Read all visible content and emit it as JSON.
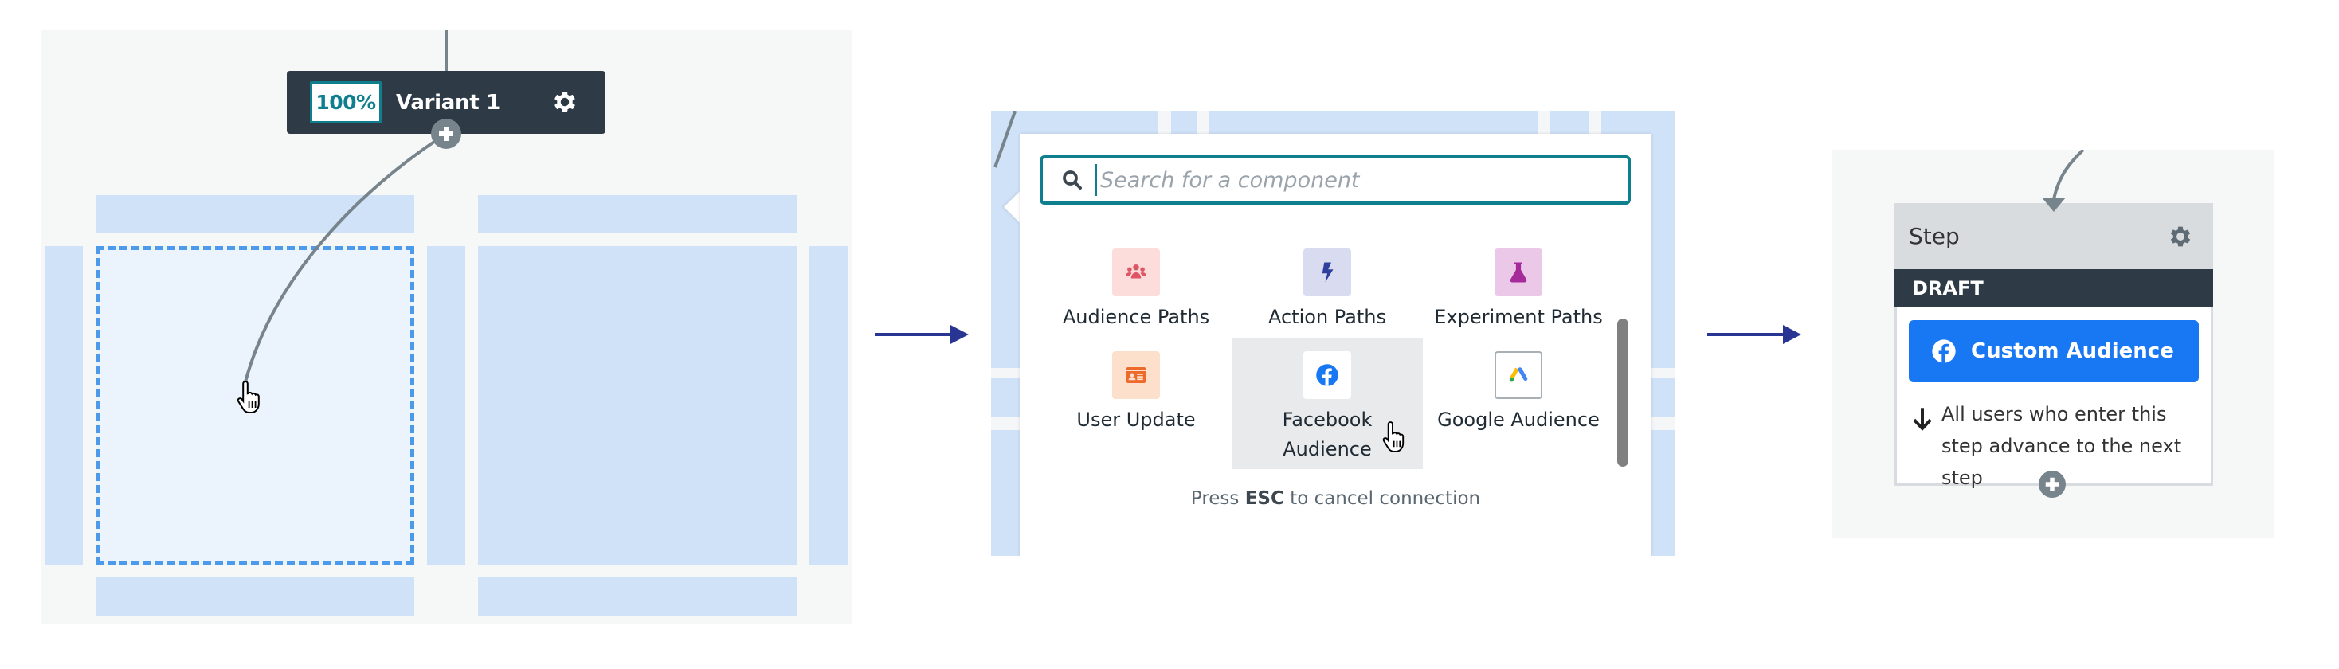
{
  "panel1": {
    "variant": {
      "percent_label": "100%",
      "name": "Variant 1",
      "settings_icon": "gear-icon",
      "add_icon": "plus-circle-icon"
    },
    "cursor": "hand-pointer-cursor"
  },
  "flow_arrows": [
    "arrow-right-icon",
    "arrow-right-icon"
  ],
  "panel2": {
    "search": {
      "placeholder": "Search for a component",
      "value": "",
      "icon": "search-icon"
    },
    "components": [
      {
        "label": "Audience Paths",
        "icon": "users-icon",
        "tile_color": "#fddcdc",
        "icon_color": "#e05564",
        "hovered": false
      },
      {
        "label": "Action Paths",
        "icon": "bolt-icon",
        "tile_color": "#d9dcf0",
        "icon_color": "#2f3f9e",
        "hovered": false
      },
      {
        "label": "Experiment Paths",
        "icon": "flask-icon",
        "tile_color": "#ecc8e8",
        "icon_color": "#a52a9a",
        "hovered": false
      },
      {
        "label": "User Update",
        "icon": "id-card-icon",
        "tile_color": "#fde0cc",
        "icon_color": "#ec6a2c",
        "hovered": false
      },
      {
        "label": "Facebook Audience",
        "icon": "facebook-icon",
        "tile_color": "#ffffff",
        "icon_color": "#1877f2",
        "hovered": true
      },
      {
        "label": "Google Audience",
        "icon": "google-ads-icon",
        "tile_color": "#ffffff",
        "icon_color": "#4285f4",
        "hovered": false
      }
    ],
    "esc_hint": {
      "prefix": "Press ",
      "key": "ESC",
      "suffix": " to cancel connection"
    }
  },
  "panel3": {
    "step": {
      "title": "Step",
      "status": "DRAFT",
      "action_label": "Custom Audience",
      "action_icon": "facebook-icon",
      "advance_text": "All users who enter this step advance to the next step",
      "advance_icon": "arrow-down-icon"
    }
  },
  "colors": {
    "teal_accent": "#0f7f8e",
    "dark_bar": "#2e3a45",
    "facebook_blue": "#1877f2",
    "flow_arrow": "#283593",
    "connector_gray": "#78848c",
    "dropzone_border": "#4e9aea",
    "canvas_block": "#d0e2f8"
  }
}
